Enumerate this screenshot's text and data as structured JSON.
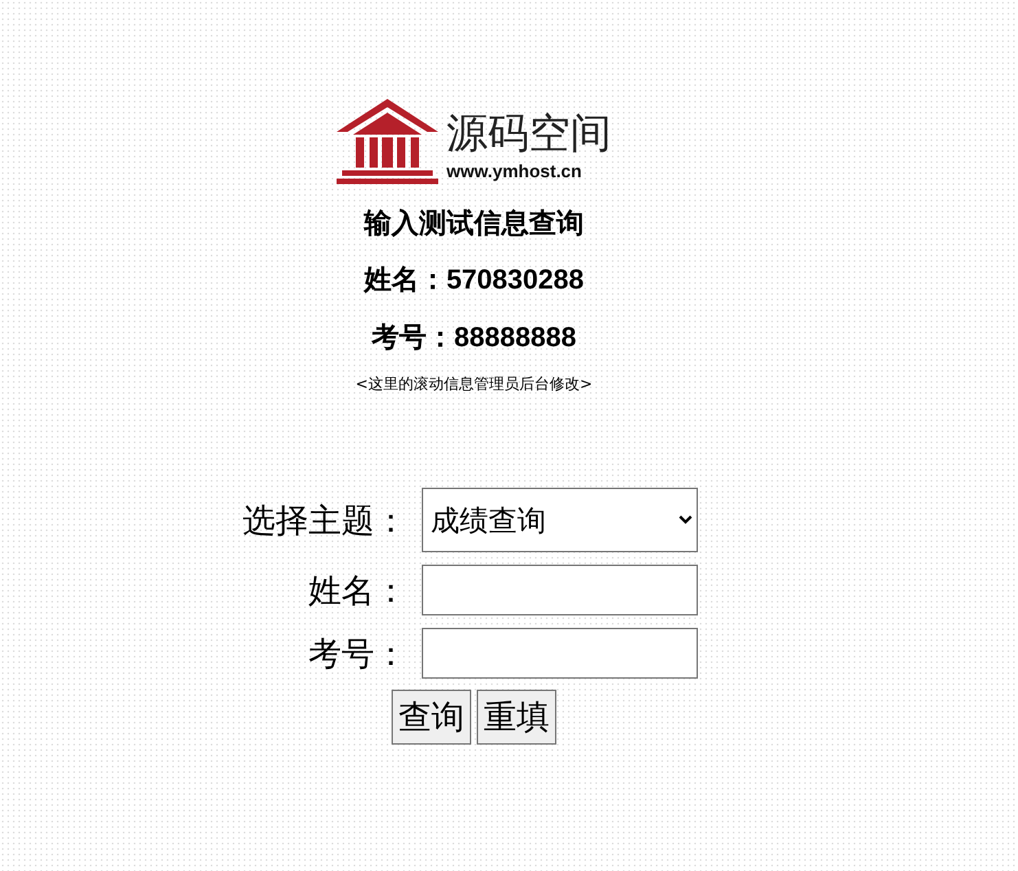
{
  "logo": {
    "name": "源码空间",
    "url": "www.ymhost.cn"
  },
  "heading": "输入测试信息查询",
  "info": [
    {
      "label": "姓名：",
      "value": "570830288"
    },
    {
      "label": "考号：",
      "value": "88888888"
    }
  ],
  "notice": "<这里的滚动信息管理员后台修改>",
  "form": {
    "fields": [
      {
        "kind": "select",
        "label": "选择主题：",
        "value": "成绩查询"
      },
      {
        "kind": "input",
        "label": "姓名："
      },
      {
        "kind": "input",
        "label": "考号："
      }
    ],
    "buttons": [
      "查询",
      "重填"
    ]
  }
}
